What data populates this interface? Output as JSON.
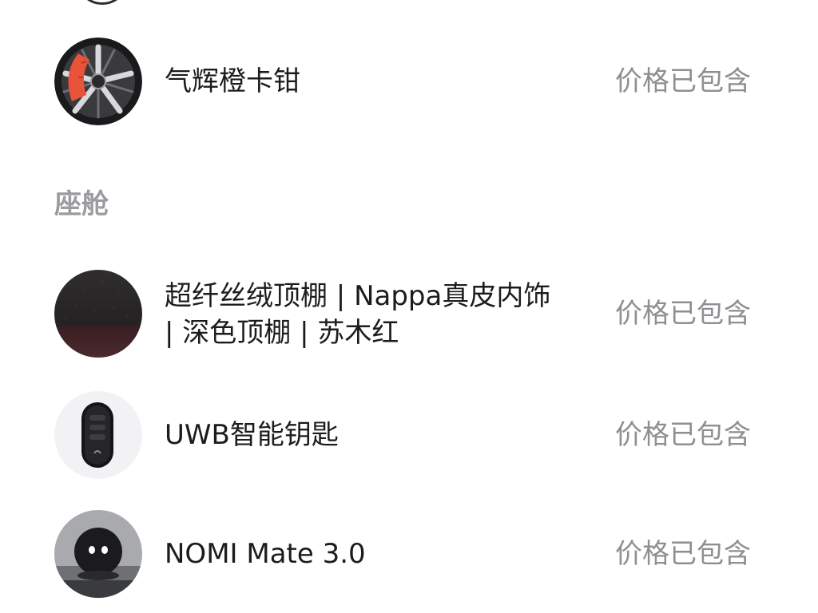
{
  "exterior": {
    "items": [
      {
        "name": "气辉橙卡钳",
        "price": "价格已包含",
        "icon": "orange-brake-caliper-image"
      }
    ]
  },
  "cabin": {
    "title": "座舱",
    "items": [
      {
        "name": "超纤丝绒顶棚 | Nappa真皮内饰 | 深色顶棚 | 苏木红",
        "price": "价格已包含",
        "icon": "interior-material-swatch-image"
      },
      {
        "name": "UWB智能钥匙",
        "price": "价格已包含",
        "icon": "smart-key-image"
      },
      {
        "name": "NOMI Mate 3.0",
        "price": "价格已包含",
        "icon": "nomi-robot-image"
      }
    ]
  },
  "colors": {
    "text_primary": "#1c1c1f",
    "text_secondary": "#8e8e93",
    "section_title": "#9b9ba0",
    "caliper_accent": "#e8533a",
    "swatch_dark": "#2d2b2b",
    "swatch_red": "#3b1f22"
  }
}
